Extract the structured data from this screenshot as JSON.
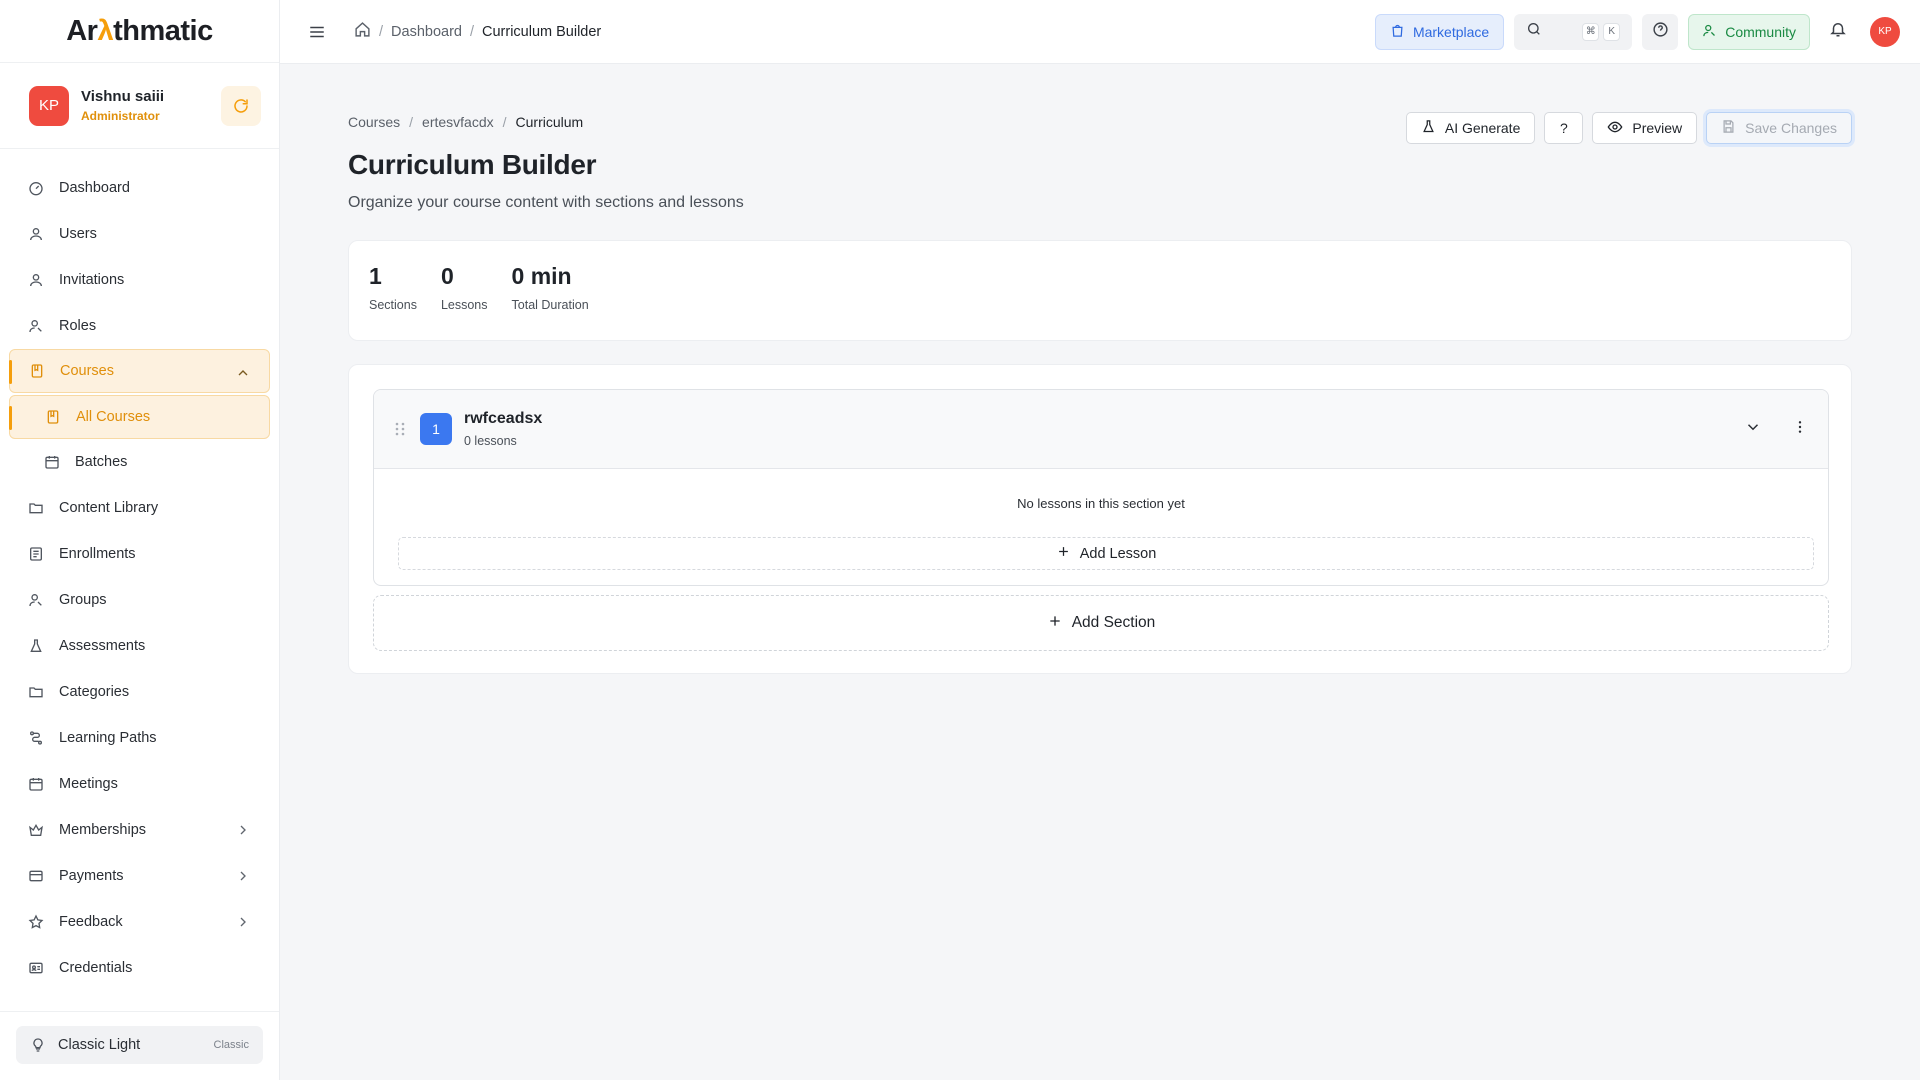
{
  "brand": {
    "logo_prefix": "Ar",
    "logo_accent": "λ",
    "logo_suffix": "thmatic",
    "accent_color": "#f59e0b"
  },
  "user": {
    "initials": "KP",
    "name": "Vishnu saiii",
    "role": "Administrator"
  },
  "sidebar": {
    "items": [
      {
        "label": "Dashboard",
        "icon": "dashboard-icon"
      },
      {
        "label": "Users",
        "icon": "user-icon"
      },
      {
        "label": "Invitations",
        "icon": "user-icon"
      },
      {
        "label": "Roles",
        "icon": "users-icon"
      },
      {
        "label": "Courses",
        "icon": "book-icon",
        "active": true,
        "expanded": true
      },
      {
        "label": "All Courses",
        "icon": "book-icon",
        "sub": true,
        "active": true
      },
      {
        "label": "Batches",
        "icon": "calendar-icon",
        "sub": true
      },
      {
        "label": "Content Library",
        "icon": "folder-icon"
      },
      {
        "label": "Enrollments",
        "icon": "list-icon"
      },
      {
        "label": "Groups",
        "icon": "users-icon"
      },
      {
        "label": "Assessments",
        "icon": "flask-icon"
      },
      {
        "label": "Categories",
        "icon": "folder-icon"
      },
      {
        "label": "Learning Paths",
        "icon": "route-icon"
      },
      {
        "label": "Meetings",
        "icon": "calendar-icon"
      },
      {
        "label": "Memberships",
        "icon": "crown-icon",
        "has_children": true
      },
      {
        "label": "Payments",
        "icon": "card-icon",
        "has_children": true
      },
      {
        "label": "Feedback",
        "icon": "star-icon",
        "has_children": true
      },
      {
        "label": "Credentials",
        "icon": "id-card-icon"
      }
    ],
    "theme": {
      "label": "Classic Light",
      "tag": "Classic"
    }
  },
  "topbar": {
    "breadcrumb": [
      "Dashboard",
      "Curriculum Builder"
    ],
    "marketplace_label": "Marketplace",
    "search_shortcut": [
      "⌘",
      "K"
    ],
    "community_label": "Community",
    "avatar_initials": "KP"
  },
  "page": {
    "breadcrumb": [
      "Courses",
      "ertesvfacdx",
      "Curriculum"
    ],
    "title": "Curriculum Builder",
    "subtitle": "Organize your course content with sections and lessons",
    "actions": {
      "ai_generate": "AI Generate",
      "help": "?",
      "preview": "Preview",
      "save": "Save Changes"
    }
  },
  "stats": [
    {
      "value": "1",
      "label": "Sections"
    },
    {
      "value": "0",
      "label": "Lessons"
    },
    {
      "value": "0 min",
      "label": "Total Duration"
    }
  ],
  "sections": [
    {
      "number": "1",
      "title": "rwfceadsx",
      "lesson_count": "0 lessons",
      "empty_text": "No lessons in this section yet",
      "add_lesson_label": "Add Lesson"
    }
  ],
  "add_section_label": "Add Section"
}
